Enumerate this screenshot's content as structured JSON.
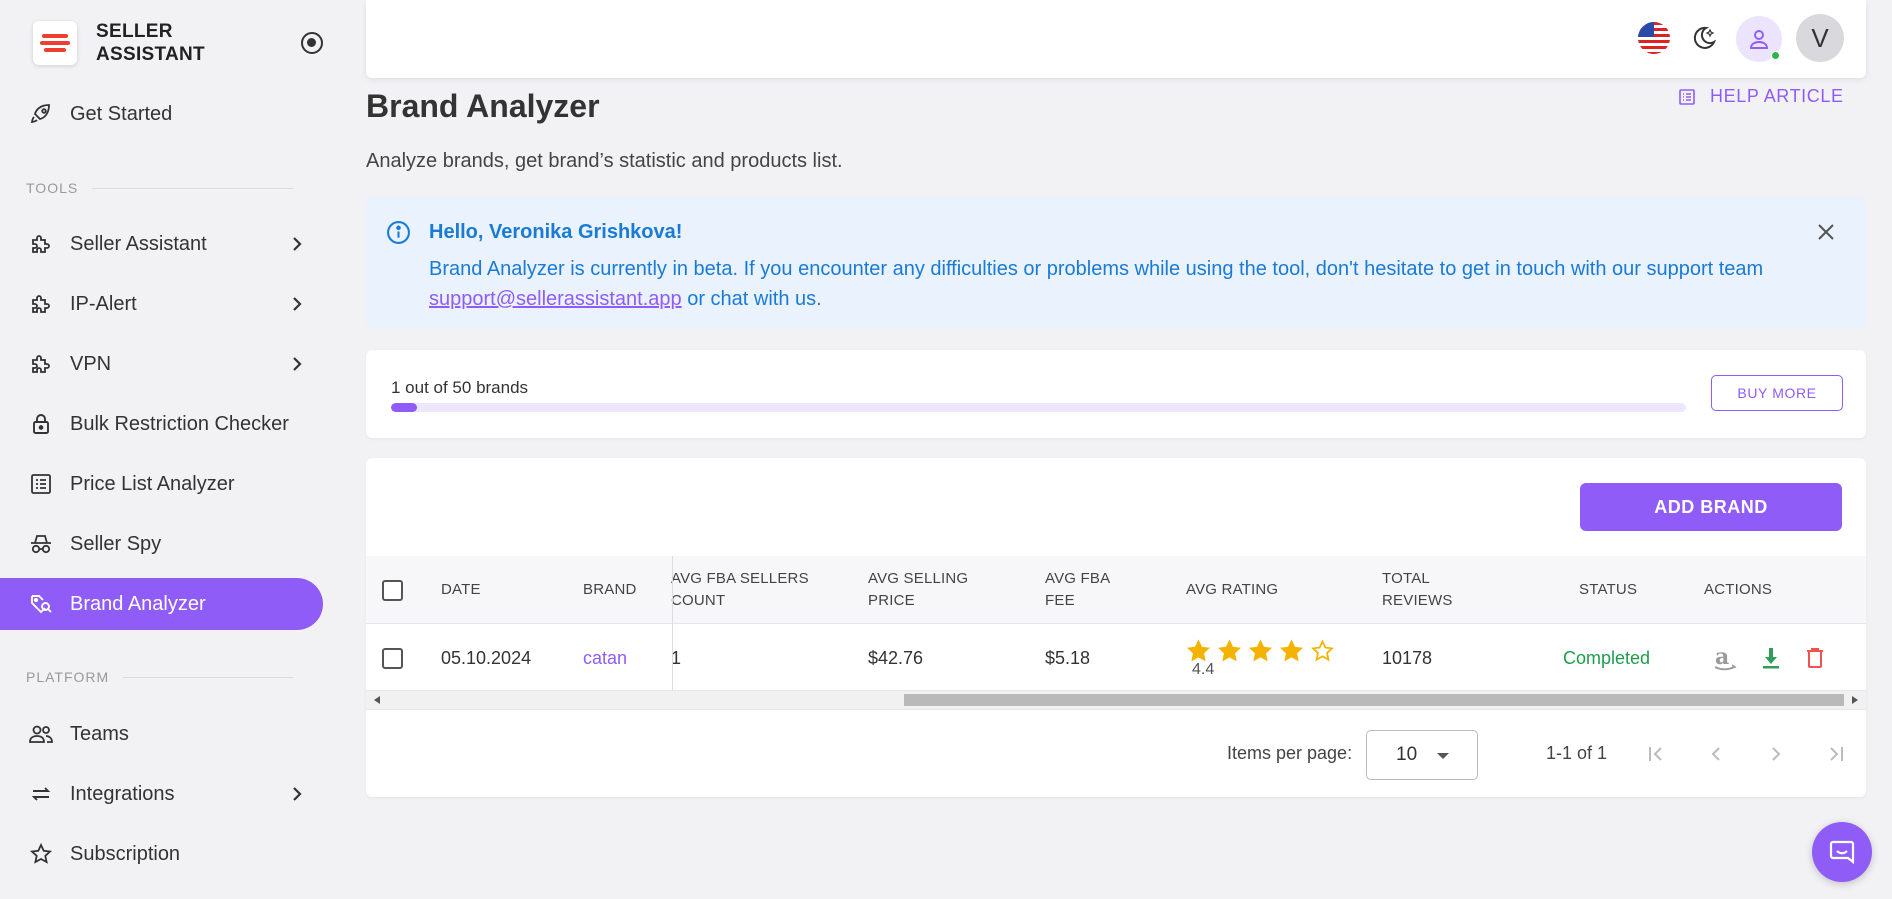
{
  "brand": {
    "line1": "SELLER",
    "line2": "ASSISTANT"
  },
  "sidebar": {
    "get_started": "Get Started",
    "tools_label": "TOOLS",
    "platform_label": "PLATFORM",
    "tools": [
      {
        "label": "Seller Assistant",
        "icon": "puzzle-icon",
        "has_chevron": true
      },
      {
        "label": "IP-Alert",
        "icon": "puzzle-icon",
        "has_chevron": true
      },
      {
        "label": "VPN",
        "icon": "puzzle-icon",
        "has_chevron": true
      },
      {
        "label": "Bulk Restriction Checker",
        "icon": "lock-icon"
      },
      {
        "label": "Price List Analyzer",
        "icon": "list-icon"
      },
      {
        "label": "Seller Spy",
        "icon": "spy-icon"
      },
      {
        "label": "Brand Analyzer",
        "icon": "tag-search-icon",
        "active": true
      }
    ],
    "platform": [
      {
        "label": "Teams",
        "icon": "team-icon"
      },
      {
        "label": "Integrations",
        "icon": "sync-icon",
        "has_chevron": true
      },
      {
        "label": "Subscription",
        "icon": "star-icon"
      }
    ]
  },
  "topbar": {
    "avatar_initial": "V"
  },
  "page": {
    "title": "Brand Analyzer",
    "help_link": "HELP ARTICLE",
    "subtitle": "Analyze brands, get brand’s statistic and products list."
  },
  "alert": {
    "title": "Hello, Veronika Grishkova!",
    "body_before": "Brand Analyzer is currently in beta. If you encounter any difficulties or problems while using the tool, don't hesitate to get in touch with our support team ",
    "email": "support@sellerassistant.app",
    "body_after": " or chat with us."
  },
  "quota": {
    "label": "1 out of 50 brands",
    "used": 1,
    "total": 50,
    "buy_label": "BUY MORE"
  },
  "table": {
    "add_label": "ADD BRAND",
    "headers": {
      "date": "DATE",
      "brand": "BRAND",
      "sellers_1": "AVG FBA SELLERS",
      "sellers_2": "COUNT",
      "price_1": "AVG SELLING",
      "price_2": "PRICE",
      "fee_1": "AVG FBA",
      "fee_2": "FEE",
      "rating": "AVG RATING",
      "reviews_1": "TOTAL",
      "reviews_2": "REVIEWS",
      "status": "STATUS",
      "actions": "ACTIONS"
    },
    "rows": [
      {
        "date": "05.10.2024",
        "brand": "catan",
        "sellers": "1",
        "price": "$42.76",
        "fee": "$5.18",
        "rating": "4.4",
        "rating_value": 4.4,
        "reviews": "10178",
        "status": "Completed"
      }
    ]
  },
  "pagination": {
    "items_per_page_label": "Items per page:",
    "page_size": "10",
    "range": "1-1 of 1"
  },
  "colors": {
    "accent": "#8f5cf7",
    "info_blue": "#1a7bd6",
    "success": "#1f9d4c",
    "danger": "#ef5350",
    "star": "#f5b301"
  }
}
